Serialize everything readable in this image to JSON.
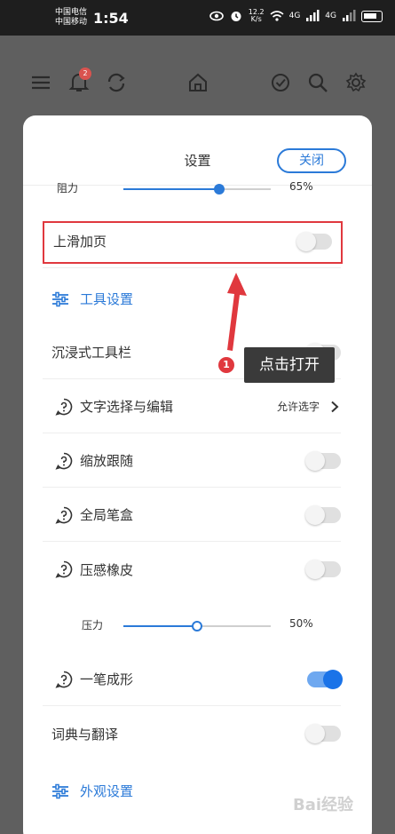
{
  "status_bar": {
    "carrier_1": "中国电信",
    "carrier_2": "中国移动",
    "time": "1:54",
    "net_speed": "12.2",
    "net_unit": "K/s",
    "signal_1": "4G",
    "signal_2": "4G"
  },
  "app_bar": {
    "notification_count": "2"
  },
  "sheet": {
    "title": "设置",
    "close_label": "关闭",
    "resistance": {
      "label": "阻力",
      "percent_text": "65%",
      "percent": 65
    },
    "swipe_up_add_page": {
      "label": "上滑加页",
      "enabled": false
    },
    "tool_settings_section": "工具设置",
    "immersive_toolbar": {
      "label": "沉浸式工具栏",
      "enabled": false
    },
    "text_select_edit": {
      "label": "文字选择与编辑",
      "value": "允许选字"
    },
    "zoom_follow": {
      "label": "缩放跟随",
      "enabled": false
    },
    "global_pen_box": {
      "label": "全局笔盒",
      "enabled": false
    },
    "pressure_eraser": {
      "label": "压感橡皮",
      "enabled": false
    },
    "pressure": {
      "label": "压力",
      "percent_text": "50%",
      "percent": 50
    },
    "one_stroke_shape": {
      "label": "一笔成形",
      "enabled": true
    },
    "dictionary_translate": {
      "label": "词典与翻译",
      "enabled": false
    },
    "appearance_section": "外观设置"
  },
  "annotation": {
    "step_number": "1",
    "tooltip": "点击打开",
    "highlight_color": "#e0383e"
  },
  "colors": {
    "accent": "#2b7ad8",
    "toggle_on": "#1a73e8"
  }
}
